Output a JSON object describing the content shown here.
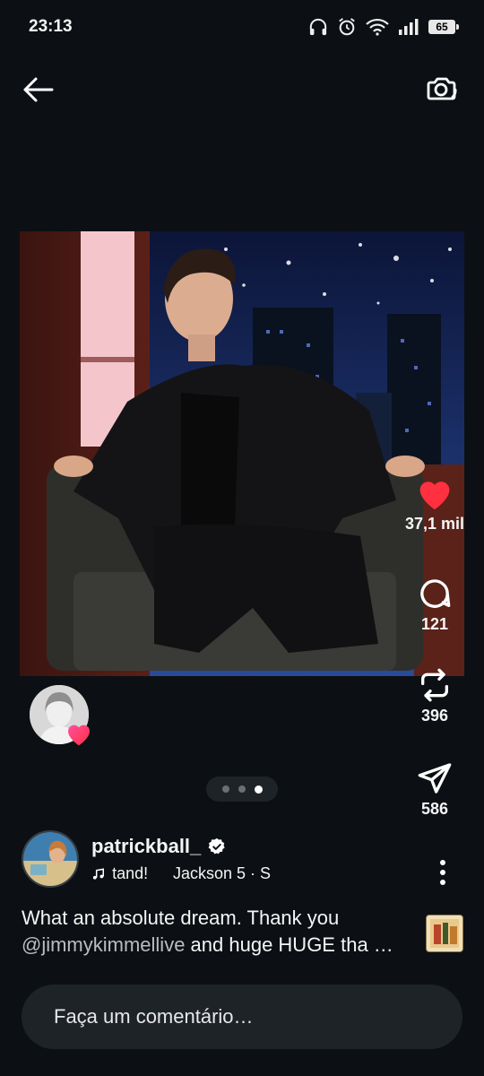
{
  "status_bar": {
    "time": "23:13",
    "battery": "65",
    "icons": [
      "headphones-icon",
      "alarm-icon",
      "wifi-icon",
      "signal-icon",
      "battery-icon"
    ]
  },
  "top_bar": {
    "back_icon": "arrow-left-icon",
    "camera_icon": "camera-switch-icon"
  },
  "post": {
    "image_description_icon": "photo",
    "actions": {
      "likes": "37,1 mil",
      "comments": "121",
      "reposts": "396",
      "shares": "586"
    },
    "carousel": {
      "total": 3,
      "active_index": 2
    },
    "author": {
      "username": "patrickball_",
      "verified": true
    },
    "music": {
      "track": "tand!",
      "artist": "Jackson 5 · S"
    },
    "caption": {
      "line1": "What an absolute dream. Thank you",
      "mention": "@jimmykimmellive",
      "line2_rest": " and huge HUGE tha …"
    },
    "comment_placeholder": "Faça um comentário…"
  },
  "colors": {
    "background": "#0c1014",
    "like_red": "#ff3040",
    "input_bg": "#1e2328"
  }
}
